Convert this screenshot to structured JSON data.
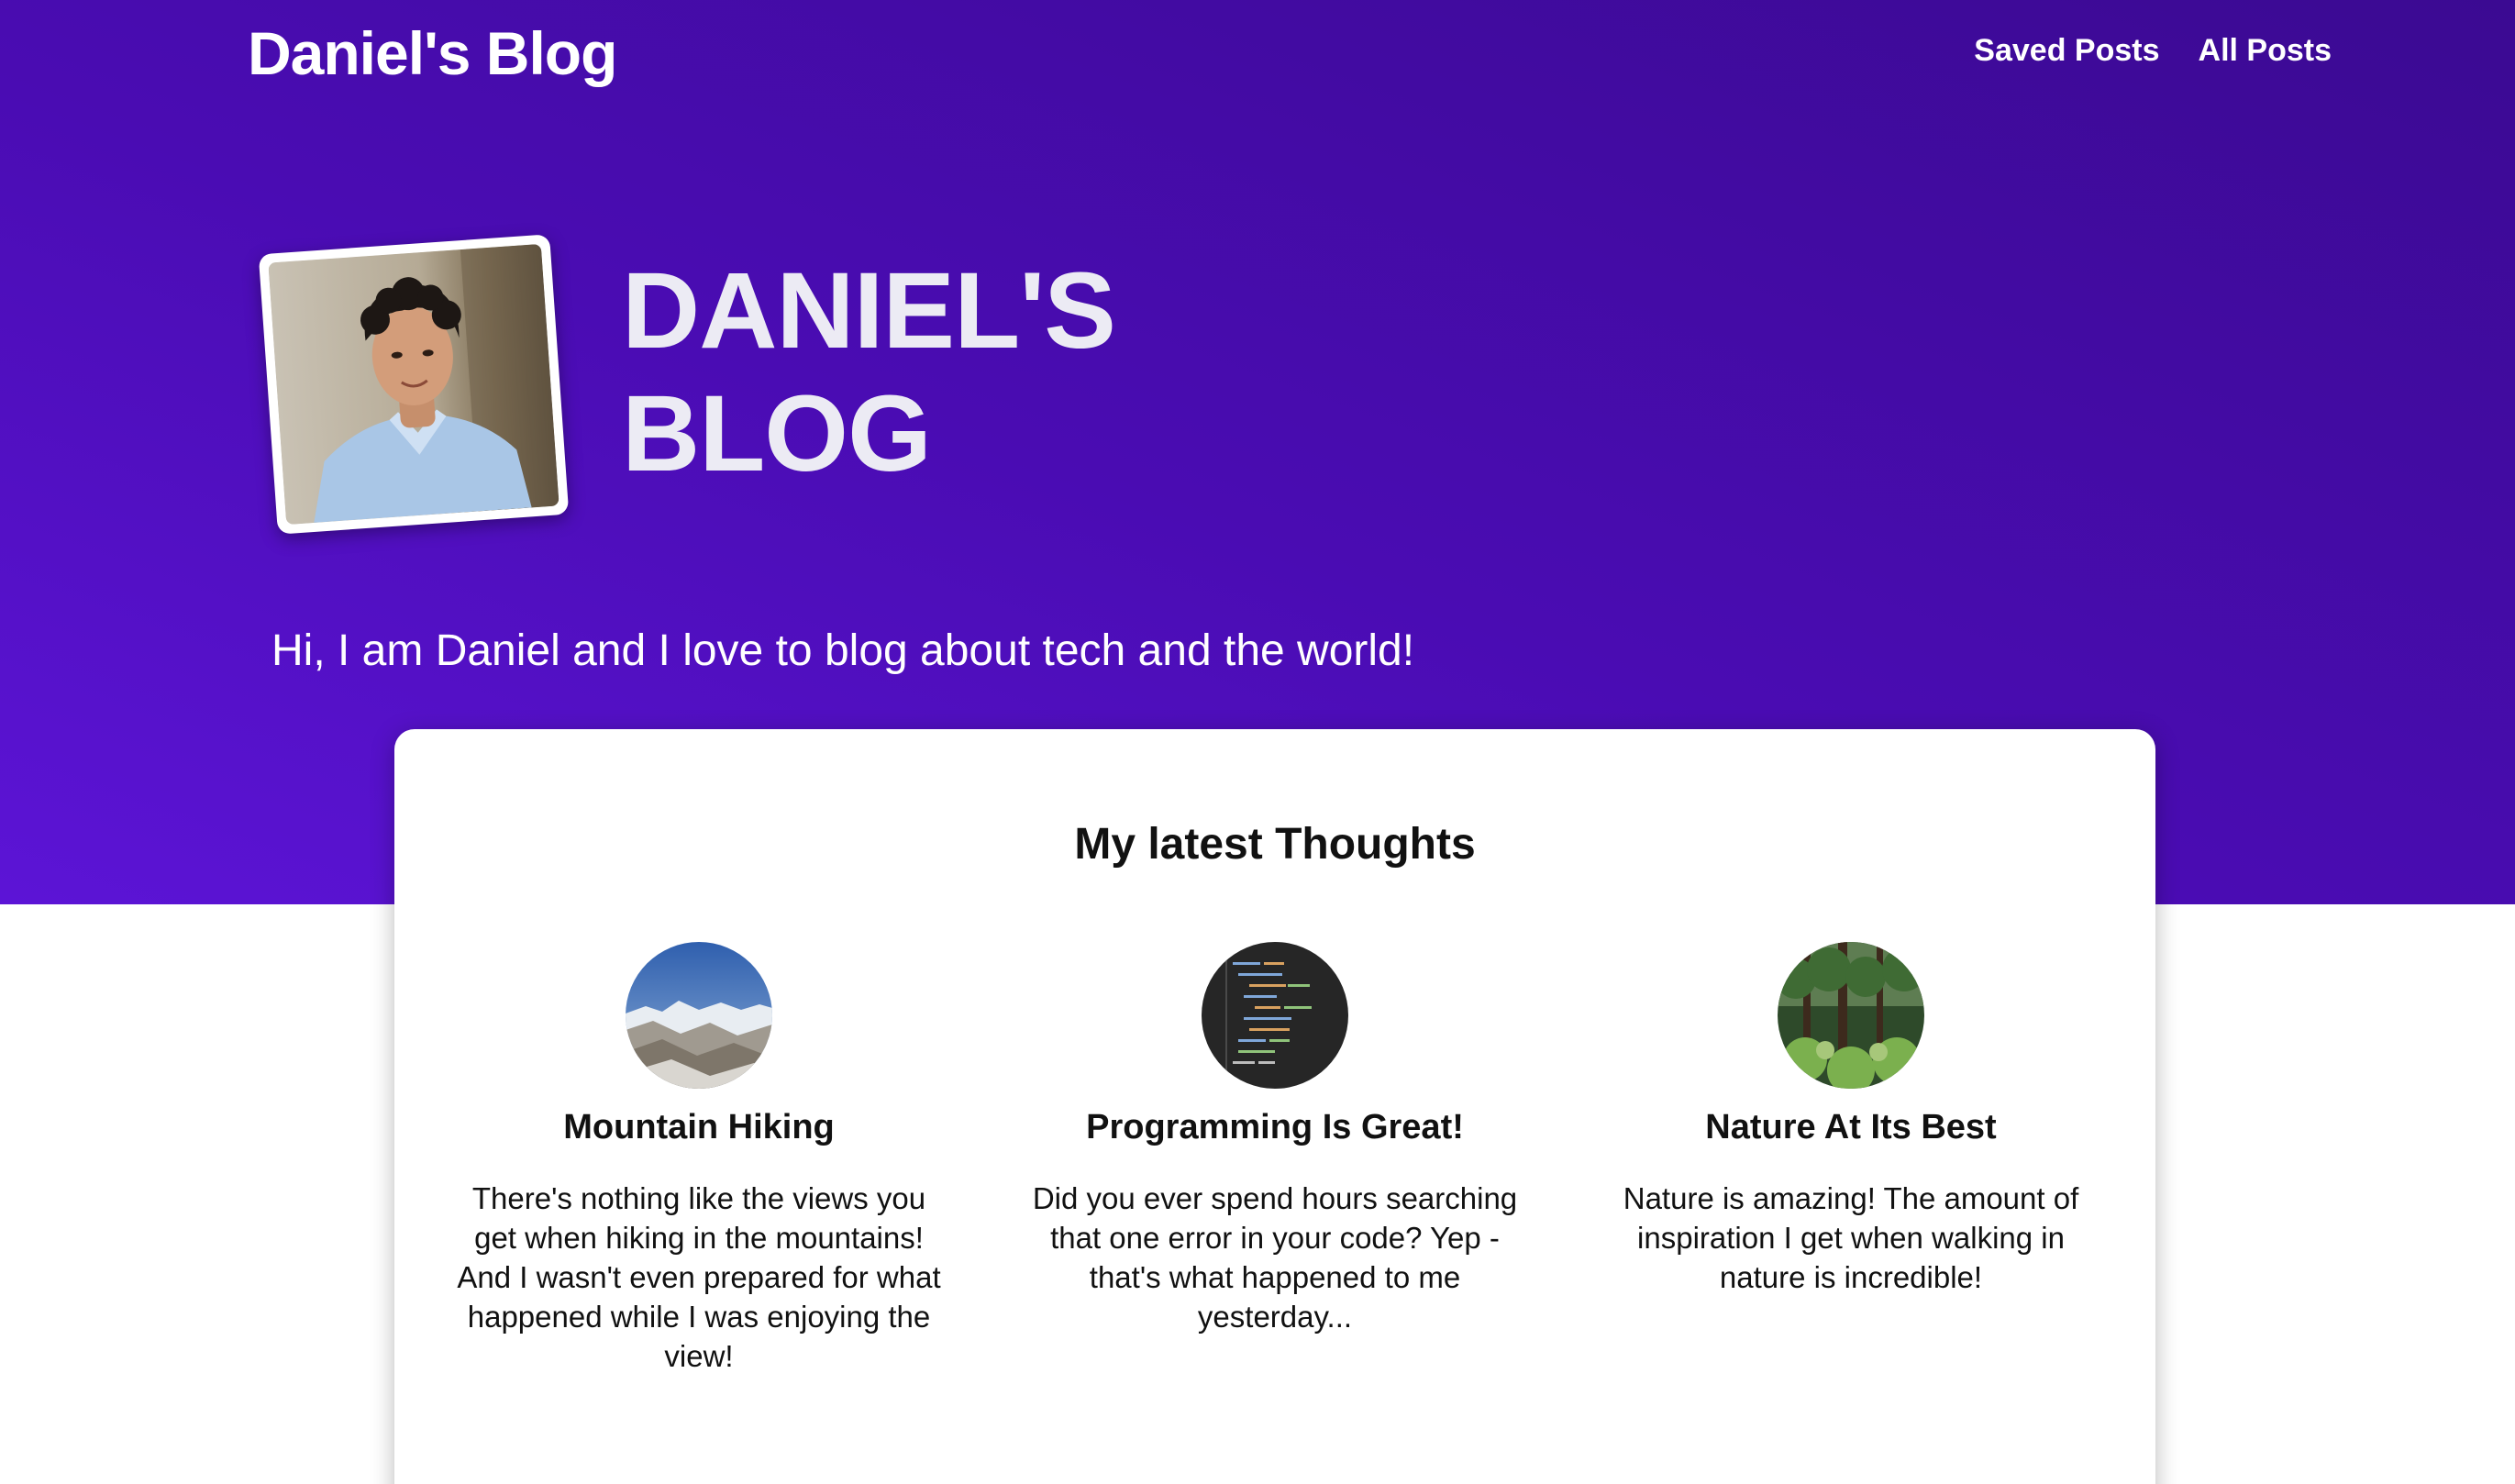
{
  "nav": {
    "brand": "Daniel's Blog",
    "links": [
      "Saved Posts",
      "All Posts"
    ]
  },
  "hero": {
    "title_line1": "DANIEL'S",
    "title_line2": "BLOG",
    "tagline": "Hi, I am Daniel and I love to blog about tech and the world!"
  },
  "latest": {
    "heading": "My latest Thoughts",
    "posts": [
      {
        "title": "Mountain Hiking",
        "excerpt": "There's nothing like the views you get when hiking in the mountains! And I wasn't even prepared for what happened while I was enjoying the view!",
        "image_icon": "mountain-image"
      },
      {
        "title": "Programming Is Great!",
        "excerpt": "Did you ever spend hours searching that one error in your code? Yep - that's what happened to me yesterday...",
        "image_icon": "code-image"
      },
      {
        "title": "Nature At Its Best",
        "excerpt": "Nature is amazing! The amount of inspiration I get when walking in nature is incredible!",
        "image_icon": "forest-image"
      }
    ]
  },
  "colors": {
    "hero_gradient_start": "#5c14d6",
    "hero_gradient_end": "#3b0a92",
    "card_background": "#ffffff"
  }
}
